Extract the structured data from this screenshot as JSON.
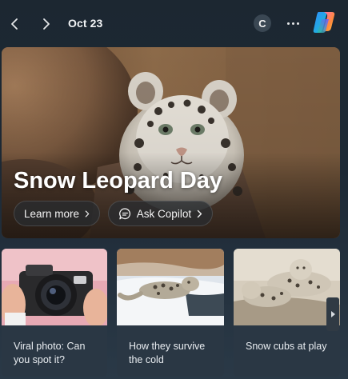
{
  "header": {
    "date": "Oct 23",
    "avatar_initial": "C",
    "back_icon": "chevron-left-icon",
    "forward_icon": "chevron-right-icon",
    "more_icon": "more-horizontal-icon",
    "copilot_icon": "copilot-logo-icon"
  },
  "hero": {
    "title": "Snow Leopard Day",
    "learn_more_label": "Learn more",
    "ask_copilot_label": "Ask Copilot"
  },
  "cards": [
    {
      "caption": "Viral photo: Can you spot it?"
    },
    {
      "caption": "How they survive the cold"
    },
    {
      "caption": "Snow cubs at play"
    }
  ],
  "colors": {
    "background": "#1d2935",
    "card": "#2a3744",
    "pill": "#2c3034",
    "text": "#ffffff"
  }
}
